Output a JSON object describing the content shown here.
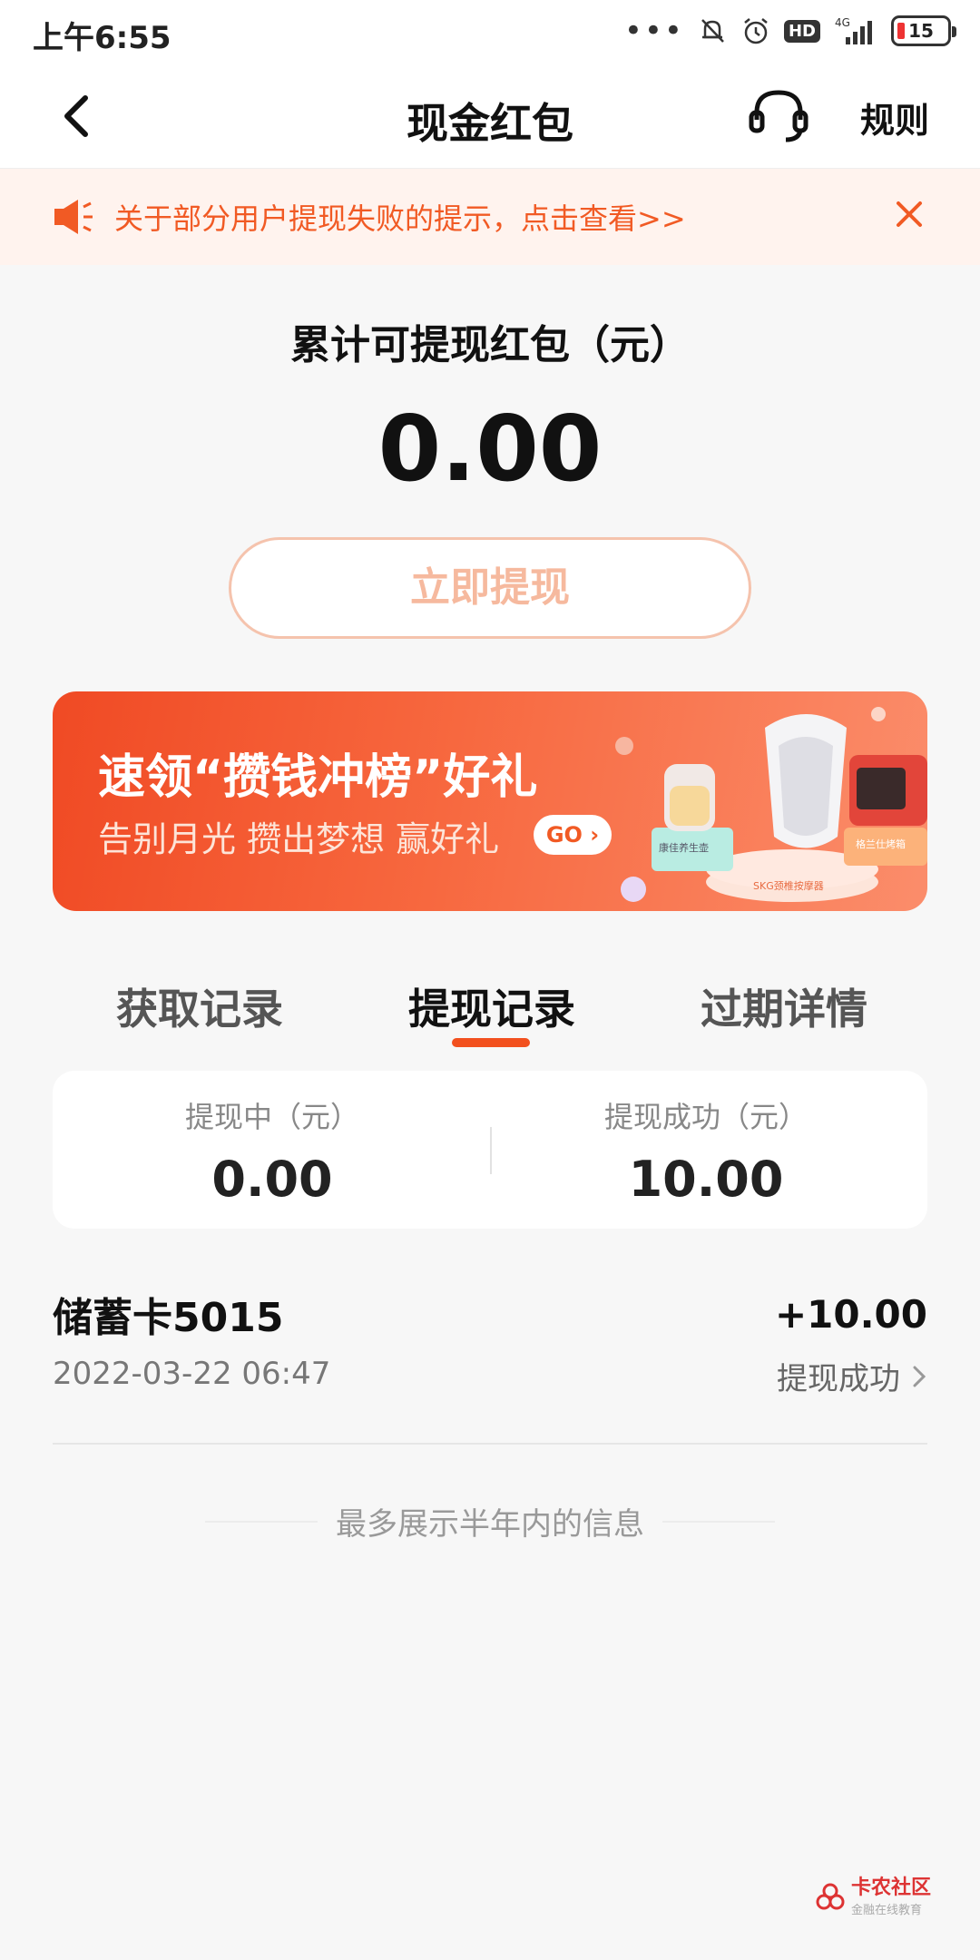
{
  "status_bar": {
    "time": "上午6:55",
    "network": "4G",
    "battery": "15",
    "hd": "HD"
  },
  "header": {
    "title": "现金红包",
    "rules": "规则"
  },
  "notice": {
    "text": "关于部分用户提现失败的提示，点击查看>>"
  },
  "balance": {
    "label": "累计可提现红包（元）",
    "value": "0.00",
    "withdraw_button": "立即提现"
  },
  "banner": {
    "title": "速领“攒钱冲榜”好礼",
    "subtitle": "告别月光 攒出梦想 赢好礼",
    "go": "GO",
    "tag_left": "康佳养生壶",
    "tag_right": "格兰仕烤箱",
    "tag_center": "SKG颈椎按摩器"
  },
  "tabs": [
    {
      "label": "获取记录"
    },
    {
      "label": "提现记录"
    },
    {
      "label": "过期详情"
    }
  ],
  "summary": {
    "pending_label": "提现中（元）",
    "pending_value": "0.00",
    "success_label": "提现成功（元）",
    "success_value": "10.00"
  },
  "records": [
    {
      "name": "储蓄卡5015",
      "time": "2022-03-22 06:47",
      "amount": "+10.00",
      "status": "提现成功"
    }
  ],
  "footer": {
    "note": "最多展示半年内的信息"
  },
  "watermark": {
    "brand": "卡农社区",
    "sub": "金融在线教育"
  },
  "colors": {
    "accent": "#f2501e",
    "notice_bg": "#fff3ee",
    "button_text": "#f6b99e"
  }
}
